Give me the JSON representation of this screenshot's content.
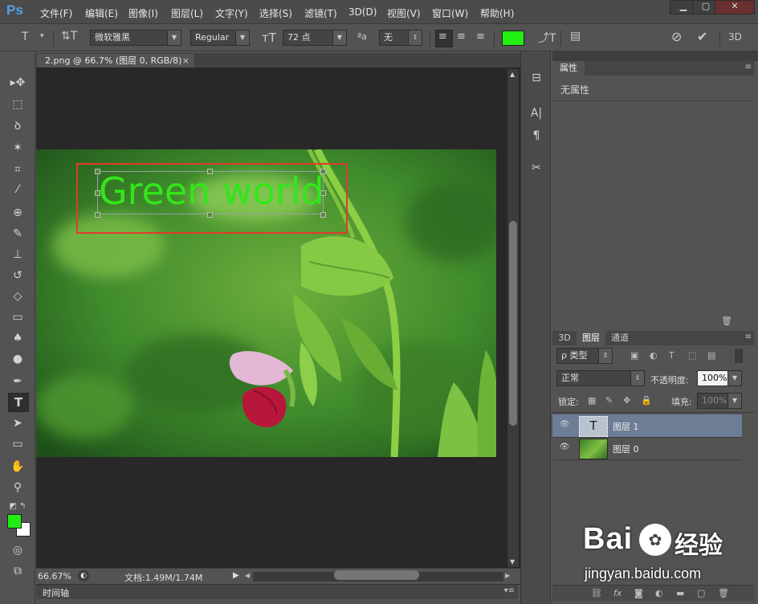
{
  "app": {
    "logo": "Ps"
  },
  "menu": [
    "文件(F)",
    "编辑(E)",
    "图像(I)",
    "图层(L)",
    "文字(Y)",
    "选择(S)",
    "滤镜(T)",
    "3D(D)",
    "视图(V)",
    "窗口(W)",
    "帮助(H)"
  ],
  "window_controls": {
    "minimize": "▁",
    "maximize": "▢",
    "close": "✕"
  },
  "options": {
    "font_family": "微软雅黑",
    "font_style": "Regular",
    "font_size": "72 点",
    "aa_label": "ªa",
    "antialias": "无",
    "text_color": "#22ee11",
    "mode_3d": "3D"
  },
  "document": {
    "tab_title": "2.png @ 66.7% (图层 0, RGB/8)",
    "close_glyph": "×",
    "canvas_text": "Green world",
    "text_color": "#33e61a",
    "selection_color": "#e03b2a"
  },
  "status": {
    "zoom": "66.67%",
    "doc_size": "文档:1.49M/1.74M"
  },
  "timeline": {
    "label": "时间轴"
  },
  "properties": {
    "tab": "属性",
    "empty_text": "无属性"
  },
  "layers_panel": {
    "tabs": [
      "3D",
      "图层",
      "通道"
    ],
    "active_tab": "图层",
    "filter_label": "类型",
    "filter_prefix": "ρ",
    "blend_mode": "正常",
    "opacity_label": "不透明度:",
    "opacity": "100%",
    "lock_label": "锁定:",
    "fill_label": "填充:",
    "fill": "100%",
    "layers": [
      {
        "name": "图层 1",
        "thumb": "T",
        "selected": true
      },
      {
        "name": "图层 0",
        "thumb": "",
        "selected": false
      }
    ],
    "footer_icons": [
      "link-icon",
      "fx-icon",
      "mask-icon",
      "adjustment-icon",
      "folder-icon",
      "new-layer-icon",
      "trash-icon"
    ],
    "fx_label": "fx"
  },
  "colors": {
    "foreground": "#22ee11",
    "background": "#ffffff",
    "accent": "#52a2e6"
  },
  "watermark": {
    "brand": "Bai",
    "brand2": "经验",
    "url": "jingyan.baidu.com"
  }
}
